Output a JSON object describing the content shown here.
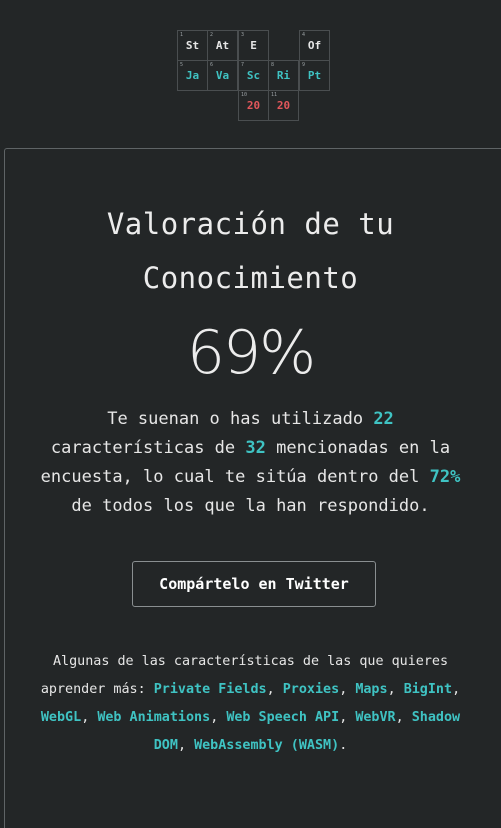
{
  "logo": {
    "cells": [
      {
        "num": "1",
        "sym": "St",
        "tone": "white"
      },
      {
        "num": "2",
        "sym": "At",
        "tone": "white"
      },
      {
        "num": "3",
        "sym": "E",
        "tone": "white"
      },
      {
        "num": "4",
        "sym": "Of",
        "tone": "white"
      },
      {
        "num": "5",
        "sym": "Ja",
        "tone": "teal"
      },
      {
        "num": "6",
        "sym": "Va",
        "tone": "teal"
      },
      {
        "num": "7",
        "sym": "Sc",
        "tone": "teal"
      },
      {
        "num": "8",
        "sym": "Ri",
        "tone": "teal"
      },
      {
        "num": "9",
        "sym": "Pt",
        "tone": "teal"
      },
      {
        "num": "10",
        "sym": "20",
        "tone": "red"
      },
      {
        "num": "11",
        "sym": "20",
        "tone": "red"
      }
    ]
  },
  "score": {
    "title_line1": "Valoración de tu",
    "title_line2": "Conocimiento",
    "percent": "69%"
  },
  "summary": {
    "p1": "Te suenan o has utilizado ",
    "known": "22",
    "p2": " características de ",
    "total": "32",
    "p3": " mencionadas en la encuesta, lo cual te sitúa dentro del ",
    "rank": "72%",
    "p4": " de todos los que la han respondido."
  },
  "share_button": "Compártelo en Twitter",
  "learn": {
    "intro": "Algunas de las características de las que quieres aprender más: ",
    "features": [
      "Private Fields",
      "Proxies",
      "Maps",
      "BigInt",
      "WebGL",
      "Web Animations",
      "Web Speech API",
      "WebVR",
      "Shadow DOM",
      "WebAssembly (WASM)"
    ],
    "separator": ", ",
    "end": "."
  },
  "colors": {
    "background": "#232627",
    "accent": "#3fc3c3",
    "logo_red": "#e2575b"
  }
}
